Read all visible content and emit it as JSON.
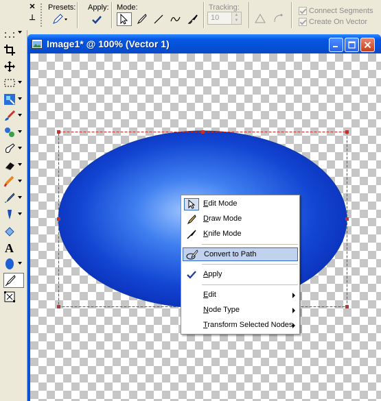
{
  "options_bar": {
    "close_glyph": "✕",
    "pin_glyph": "⊥",
    "presets_label": "Presets:",
    "apply_label": "Apply:",
    "mode_label": "Mode:",
    "tracking_label": "Tracking:",
    "tracking_value": "10",
    "connect_segments_label": "Connect Segments",
    "create_on_vector_label": "Create On Vector",
    "connect_segments_checked": true,
    "create_on_vector_checked": true,
    "mode_buttons": [
      "edit-mode-icon",
      "draw-mode-icon",
      "line-icon",
      "freehand-icon",
      "knife-icon"
    ]
  },
  "toolbox": {
    "tools": [
      "pan-hand-icon",
      "dotted-grid-icon",
      "crop-icon",
      "move-icon",
      "selection-icon",
      "dropper-icon",
      "paint-brush-icon",
      "clone-brush-icon",
      "retouch-icon",
      "eraser-icon",
      "picture-tube-icon",
      "airbrush-icon",
      "flood-fill-icon",
      "fill-bucket-icon",
      "text-icon",
      "ellipse-shape-icon",
      "pen-tool-icon",
      "object-selector-icon"
    ]
  },
  "document": {
    "title": "Image1* @ 100% (Vector 1)",
    "colors": {
      "ellipse_center": "#9cc3ff",
      "ellipse_edge": "#0a2fb8",
      "selection_box": "#c4302c"
    }
  },
  "context_menu": {
    "items": [
      {
        "label": "Edit Mode",
        "mnemonic": "E",
        "icon": "cursor-arrow-icon",
        "highlight": false,
        "submenu": false
      },
      {
        "label": "Draw Mode",
        "mnemonic": "D",
        "icon": "pencil-icon",
        "highlight": false,
        "submenu": false
      },
      {
        "label": "Knife Mode",
        "mnemonic": "K",
        "icon": "knife-icon",
        "highlight": false,
        "submenu": false
      },
      {
        "label": "Convert to Path",
        "mnemonic": "",
        "icon": "convert-to-path-icon",
        "highlight": true,
        "submenu": false
      },
      {
        "label": "Apply",
        "mnemonic": "A",
        "icon": "checkmark-icon",
        "highlight": false,
        "submenu": false
      },
      {
        "label": "Edit",
        "mnemonic": "E",
        "icon": "",
        "highlight": false,
        "submenu": true
      },
      {
        "label": "Node Type",
        "mnemonic": "N",
        "icon": "",
        "highlight": false,
        "submenu": true
      },
      {
        "label": "Transform Selected Nodes",
        "mnemonic": "T",
        "icon": "",
        "highlight": false,
        "submenu": true
      }
    ]
  }
}
